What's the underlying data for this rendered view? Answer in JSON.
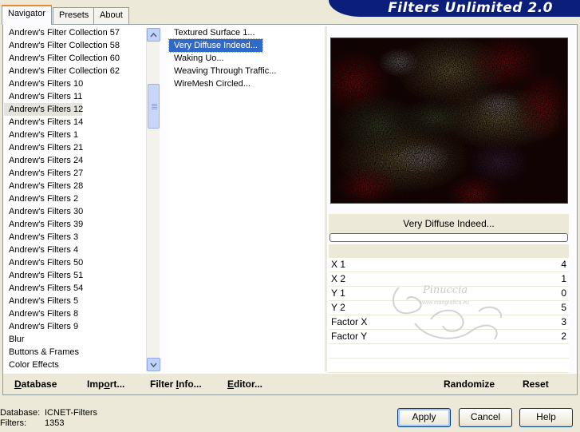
{
  "tabs": [
    {
      "label": "Navigator",
      "active": true
    },
    {
      "label": "Presets",
      "active": false
    },
    {
      "label": "About",
      "active": false
    }
  ],
  "banner": {
    "title": "Filters Unlimited 2.0",
    "color": "#0a1e7a"
  },
  "categories": {
    "selected": "Andrew's Filters 12",
    "items": [
      "Andrew's Filter Collection 57",
      "Andrew's Filter Collection 58",
      "Andrew's Filter Collection 60",
      "Andrew's Filter Collection 62",
      "Andrew's Filters 10",
      "Andrew's Filters 11",
      "Andrew's Filters 12",
      "Andrew's Filters 14",
      "Andrew's Filters 1",
      "Andrew's Filters 21",
      "Andrew's Filters 24",
      "Andrew's Filters 27",
      "Andrew's Filters 28",
      "Andrew's Filters 2",
      "Andrew's Filters 30",
      "Andrew's Filters 39",
      "Andrew's Filters 3",
      "Andrew's Filters 4",
      "Andrew's Filters 50",
      "Andrew's Filters 51",
      "Andrew's Filters 54",
      "Andrew's Filters 5",
      "Andrew's Filters 8",
      "Andrew's Filters 9",
      "Blur",
      "Buttons & Frames",
      "Color Effects"
    ]
  },
  "filters": {
    "selected": "Very Diffuse Indeed...",
    "items": [
      "Textured Surface 1...",
      "Very Diffuse Indeed...",
      "Waking Uo...",
      "Weaving Through Traffic...",
      "WireMesh Circled..."
    ]
  },
  "preview": {
    "filter_name": "Very Diffuse Indeed..."
  },
  "parameters": [
    {
      "name": "X 1",
      "value": "4"
    },
    {
      "name": "X 2",
      "value": "1"
    },
    {
      "name": "Y 1",
      "value": "0"
    },
    {
      "name": "Y 2",
      "value": "5"
    },
    {
      "name": "Factor X",
      "value": "3"
    },
    {
      "name": "Factor Y",
      "value": "2"
    }
  ],
  "watermark": {
    "name": "Pinuccia",
    "url": "www.marigrafica.eu"
  },
  "bottom_links": {
    "database": {
      "underline": "D",
      "rest": "atabase"
    },
    "import": {
      "pre": "Imp",
      "underline": "o",
      "rest": "rt..."
    },
    "filter_info": {
      "pre": "Filter ",
      "underline": "I",
      "rest": "nfo..."
    },
    "editor": {
      "underline": "E",
      "rest": "ditor..."
    },
    "randomize": "Randomize",
    "reset": "Reset"
  },
  "info": {
    "database_label": "Database:",
    "database_value": "ICNET-Filters",
    "filters_label": "Filters:",
    "filters_value": "1353"
  },
  "buttons": {
    "apply": "Apply",
    "cancel": "Cancel",
    "help": "Help"
  },
  "icons": {
    "scroll_up": "chevron-up-icon",
    "scroll_down": "chevron-down-icon"
  }
}
